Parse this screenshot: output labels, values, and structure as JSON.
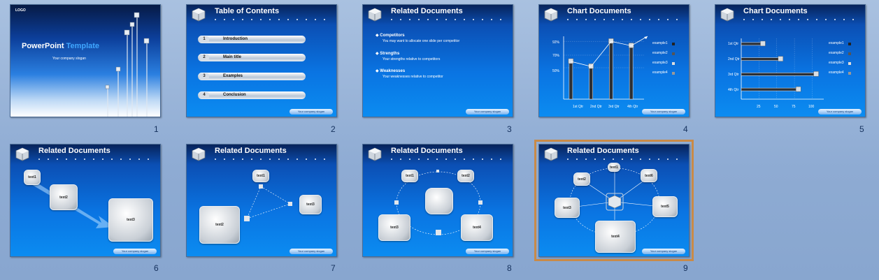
{
  "slides": [
    {
      "num": "1",
      "logo": "LOGO",
      "title_a": "PowerPoint",
      "title_b": "Template",
      "subtitle": "Your company slogan"
    },
    {
      "num": "2",
      "title": "Table of Contents",
      "items": [
        {
          "n": "1",
          "label": "Introduction"
        },
        {
          "n": "2",
          "label": "Main title"
        },
        {
          "n": "3",
          "label": "Examples"
        },
        {
          "n": "4",
          "label": "Conclusion"
        }
      ],
      "footer": "Your company slogan"
    },
    {
      "num": "3",
      "title": "Related Documents",
      "bullets": [
        {
          "head": "Competitors",
          "sub": "You may want to allocate one slide per competitor"
        },
        {
          "head": "Strengths",
          "sub": "Your strengths relative to competitors"
        },
        {
          "head": "Weaknesses",
          "sub": "Your weaknesses relative to competitor"
        }
      ],
      "footer": "Your company slogan"
    },
    {
      "num": "4",
      "title": "Chart Documents",
      "yticks": [
        "92%",
        "70%",
        "50%"
      ],
      "xticks": [
        "1st Qtr",
        "2nd Qtr",
        "3rd Qtr",
        "4th Qtr"
      ],
      "legend": [
        "example1",
        "example2",
        "example3",
        "example4"
      ],
      "footer": "Your company slogan"
    },
    {
      "num": "5",
      "title": "Chart Documents",
      "yticks": [
        "1st Qtr",
        "2nd Qtr",
        "3rd Qtr",
        "4th Qtr"
      ],
      "xticks": [
        "25",
        "50",
        "75",
        "100"
      ],
      "legend": [
        "example1",
        "example2",
        "example3",
        "example4"
      ],
      "footer": "Your company slogan"
    },
    {
      "num": "6",
      "title": "Related Documents",
      "boxes": [
        "text1",
        "text2",
        "text3"
      ],
      "footer": "Your company slogan"
    },
    {
      "num": "7",
      "title": "Related Documents",
      "boxes": [
        "text1",
        "text2",
        "text3"
      ],
      "footer": "Your company slogan"
    },
    {
      "num": "8",
      "title": "Related Documents",
      "boxes": [
        "text1",
        "text2",
        "text3",
        "text4"
      ],
      "footer": "Your company slogan"
    },
    {
      "num": "9",
      "title": "Related Documents",
      "boxes": [
        "text1",
        "text2",
        "text3",
        "text4",
        "text5",
        "text6"
      ],
      "footer": "Your company slogan"
    }
  ],
  "chart_data": [
    {
      "type": "bar",
      "title": "Chart Documents",
      "categories": [
        "1st Qtr",
        "2nd Qtr",
        "3rd Qtr",
        "4th Qtr"
      ],
      "values": [
        60,
        52,
        92,
        85
      ],
      "ylim": [
        0,
        100
      ],
      "legend_placement": "right"
    },
    {
      "type": "bar",
      "orientation": "horizontal",
      "title": "Chart Documents",
      "categories": [
        "1st Qtr",
        "2nd Qtr",
        "3rd Qtr",
        "4th Qtr"
      ],
      "values": [
        30,
        55,
        105,
        80
      ],
      "xlim": [
        0,
        100
      ],
      "legend_placement": "right"
    }
  ]
}
